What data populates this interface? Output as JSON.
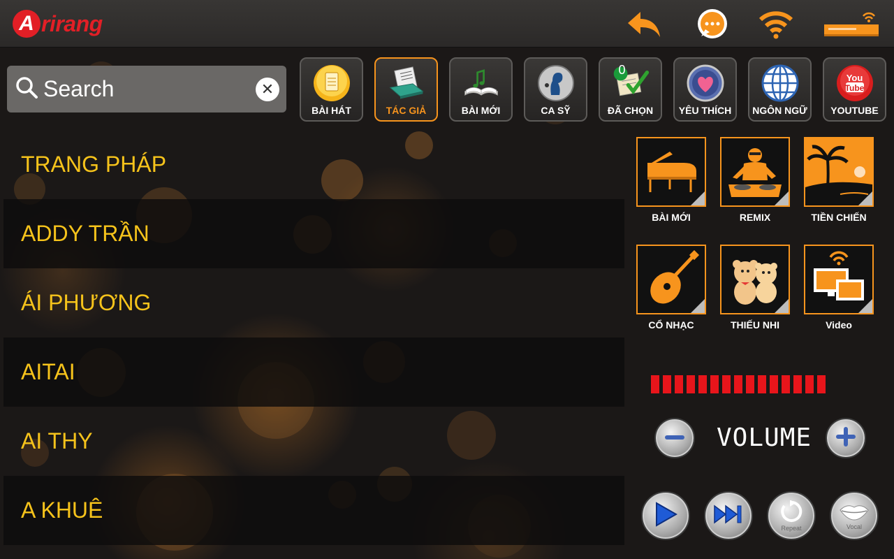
{
  "app": {
    "logo_letter": "A",
    "logo_text": "rirang"
  },
  "topbar": {
    "icons": [
      "back-arrow-icon",
      "chat-icon",
      "wifi-icon",
      "karaoke-device-icon"
    ]
  },
  "search": {
    "placeholder": "Search",
    "value": "",
    "clear_label": "✕"
  },
  "tabs": [
    {
      "label": "BÀI HÁT",
      "icon": "song-file-icon",
      "active": false
    },
    {
      "label": "TÁC GIẢ",
      "icon": "author-sheet-icon",
      "active": true
    },
    {
      "label": "BÀI MỚI",
      "icon": "new-song-book-icon",
      "active": false
    },
    {
      "label": "CA SỸ",
      "icon": "singer-icon",
      "active": false
    },
    {
      "label": "ĐÃ CHỌN",
      "icon": "selected-check-icon",
      "badge": "0",
      "active": false
    },
    {
      "label": "YÊU THÍCH",
      "icon": "heart-icon",
      "active": false
    },
    {
      "label": "NGÔN NGỮ",
      "icon": "globe-icon",
      "active": false
    },
    {
      "label": "YOUTUBE",
      "icon": "youtube-icon",
      "youtube_top": "You",
      "youtube_bottom": "Tube",
      "active": false
    }
  ],
  "artists": [
    "TRANG PHÁP",
    "ADDY TRẦN",
    "ÁI PHƯƠNG",
    "AITAI",
    "AI THY",
    "A KHUÊ"
  ],
  "genres": [
    {
      "label": "BÀI MỚI",
      "icon": "piano-icon"
    },
    {
      "label": "REMIX",
      "icon": "dj-icon"
    },
    {
      "label": "TIỀN CHIẾN",
      "icon": "beach-palm-icon"
    },
    {
      "label": "CỔ NHẠC",
      "icon": "mandolin-icon"
    },
    {
      "label": "THIẾU NHI",
      "icon": "teddy-bears-icon"
    },
    {
      "label": "Video",
      "icon": "screens-wifi-icon"
    }
  ],
  "volume": {
    "label": "VOLUME",
    "level_bars": 15,
    "total_bars": 15,
    "color": "#e8151b"
  },
  "playback": [
    {
      "name": "play-button",
      "icon": "play-icon"
    },
    {
      "name": "next-button",
      "icon": "skip-next-icon"
    },
    {
      "name": "repeat-button",
      "icon": "repeat-icon",
      "label": "Repeat"
    },
    {
      "name": "vocal-button",
      "icon": "lips-icon",
      "label": "Vocal"
    }
  ],
  "colors": {
    "accent": "#f7941d",
    "artist_text": "#f6c31b",
    "brand": "#e21f26"
  }
}
